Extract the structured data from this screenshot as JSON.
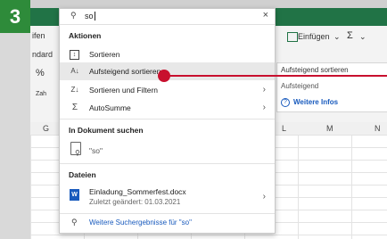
{
  "step": {
    "number": "3"
  },
  "excel": {
    "ribbon_left_texts": [
      "ifen",
      "ndard"
    ],
    "ribbon_percent": "%",
    "ribbon_zah": "Zah",
    "einfuegen": "Einfügen",
    "col_headers": [
      "G",
      "L",
      "M",
      "N"
    ]
  },
  "search": {
    "query": "so",
    "close_symbol": "×",
    "sections": {
      "actions": "Aktionen",
      "in_document": "In Dokument suchen",
      "files": "Dateien"
    },
    "actions": [
      {
        "label": "Sortieren",
        "icon": "sort-table-icon",
        "has_submenu": false
      },
      {
        "label": "Aufsteigend sortieren",
        "icon": "sort-ascending-icon",
        "has_submenu": false,
        "highlighted": true
      },
      {
        "label": "Sortieren und Filtern",
        "icon": "sort-filter-icon",
        "has_submenu": true
      },
      {
        "label": "AutoSumme",
        "icon": "sigma-icon",
        "has_submenu": true
      }
    ],
    "doc_result": "\"so\"",
    "file": {
      "name": "Einladung_Sommerfest.docx",
      "modified": "Zuletzt geändert: 01.03.2021"
    },
    "more_results": "Weitere Suchergebnisse für \"so\""
  },
  "submenu": {
    "title": "Aufsteigend sortieren",
    "subtitle": "Aufsteigend",
    "more_info": "Weitere Infos"
  },
  "colors": {
    "excel_green": "#217346",
    "badge_green": "#2e8b3a",
    "annotation_red": "#c8102e",
    "link_blue": "#185abd"
  }
}
